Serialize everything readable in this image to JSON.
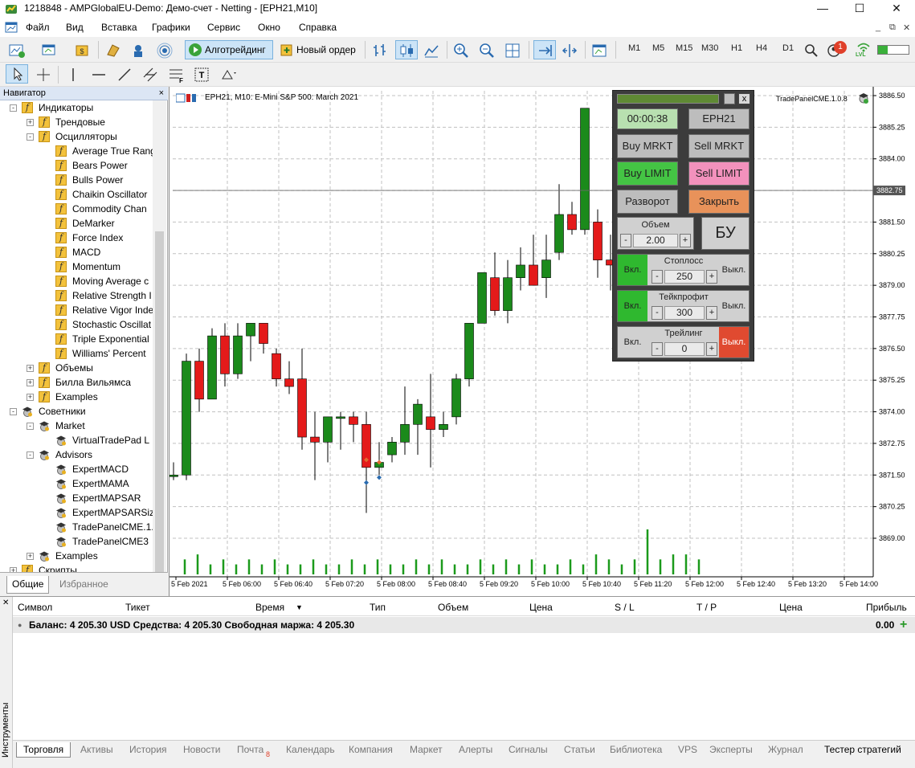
{
  "window": {
    "title": "1218848 - AMPGlobalEU-Demo: Демо-счет - Netting - [EPH21,M10]",
    "controls": {
      "minimize": "—",
      "maximize": "☐",
      "close": "✕"
    },
    "mdi_controls": [
      "_",
      "⧉",
      "✕"
    ]
  },
  "menu": [
    "Файл",
    "Вид",
    "Вставка",
    "Графики",
    "Сервис",
    "Окно",
    "Справка"
  ],
  "toolbar": {
    "algotrading_label": "Алготрейдинг",
    "new_order_label": "Новый ордер",
    "timeframes": [
      "M1",
      "M5",
      "M15",
      "M30",
      "H1",
      "H4",
      "D1"
    ],
    "notification_count": "1",
    "lvl_label": "LVL"
  },
  "navigator": {
    "title": "Навигатор",
    "close": "×",
    "items": [
      {
        "label": "Индикаторы",
        "icon": "f",
        "exp": "-"
      },
      {
        "label": "Трендовые",
        "icon": "f",
        "exp": "+"
      },
      {
        "label": "Осцилляторы",
        "icon": "f",
        "exp": "-"
      },
      {
        "label": "Average True Rang",
        "icon": "f"
      },
      {
        "label": "Bears Power",
        "icon": "f"
      },
      {
        "label": "Bulls Power",
        "icon": "f"
      },
      {
        "label": "Chaikin Oscillator",
        "icon": "f"
      },
      {
        "label": "Commodity Chan",
        "icon": "f"
      },
      {
        "label": "DeMarker",
        "icon": "f"
      },
      {
        "label": "Force Index",
        "icon": "f"
      },
      {
        "label": "MACD",
        "icon": "f"
      },
      {
        "label": "Momentum",
        "icon": "f"
      },
      {
        "label": "Moving Average c",
        "icon": "f"
      },
      {
        "label": "Relative Strength I",
        "icon": "f"
      },
      {
        "label": "Relative Vigor Inde",
        "icon": "f"
      },
      {
        "label": "Stochastic Oscillat",
        "icon": "f"
      },
      {
        "label": "Triple Exponential",
        "icon": "f"
      },
      {
        "label": "Williams' Percent",
        "icon": "f"
      },
      {
        "label": "Объемы",
        "icon": "f",
        "exp": "+"
      },
      {
        "label": "Билла Вильямса",
        "icon": "f",
        "exp": "+"
      },
      {
        "label": "Examples",
        "icon": "f",
        "exp": "+"
      },
      {
        "label": "Советники",
        "icon": "hat",
        "exp": "-"
      },
      {
        "label": "Market",
        "icon": "hat",
        "exp": "-"
      },
      {
        "label": "VirtualTradePad  L",
        "icon": "hat"
      },
      {
        "label": "Advisors",
        "icon": "hat",
        "exp": "-"
      },
      {
        "label": "ExpertMACD",
        "icon": "hat"
      },
      {
        "label": "ExpertMAMA",
        "icon": "hat"
      },
      {
        "label": "ExpertMAPSAR",
        "icon": "hat"
      },
      {
        "label": "ExpertMAPSARSize",
        "icon": "hat"
      },
      {
        "label": "TradePanelCME.1.",
        "icon": "hat"
      },
      {
        "label": "TradePanelCME3",
        "icon": "hat"
      },
      {
        "label": "Examples",
        "icon": "hat",
        "exp": "+"
      },
      {
        "label": "Скрипты",
        "icon": "f",
        "exp": "+"
      }
    ],
    "tabs": [
      "Общие",
      "Избранное"
    ]
  },
  "chart": {
    "header": "EPH21, M10:  E-Mini S&P 500: March 2021",
    "ea_label": "TradePanelCME.1.0.8",
    "current_price": "3882.75",
    "price_axis": [
      "3886.50",
      "3885.25",
      "3884.00",
      "3882.75",
      "3881.50",
      "3880.25",
      "3879.00",
      "3877.75",
      "3876.50",
      "3875.25",
      "3874.00",
      "3872.75",
      "3871.50",
      "3870.25",
      "3869.00"
    ],
    "time_axis": [
      "5 Feb 2021",
      "5 Feb 06:00",
      "5 Feb 06:40",
      "5 Feb 07:20",
      "5 Feb 08:00",
      "5 Feb 08:40",
      "5 Feb 09:20",
      "5 Feb 10:00",
      "5 Feb 10:40",
      "5 Feb 11:20",
      "5 Feb 12:00",
      "5 Feb 12:40",
      "5 Feb 13:20",
      "5 Feb 14:00"
    ],
    "colors": {
      "bull": "#1b8a1b",
      "bear": "#e41a1a",
      "grid": "#c0c0c0",
      "volume": "#1b9a1b"
    },
    "candles": [
      {
        "o": 3871.5,
        "h": 3872.0,
        "l": 3871.3,
        "c": 3871.5
      },
      {
        "o": 3871.5,
        "h": 3876.3,
        "l": 3871.3,
        "c": 3876.0
      },
      {
        "o": 3876.0,
        "h": 3876.5,
        "l": 3874.0,
        "c": 3874.5
      },
      {
        "o": 3874.5,
        "h": 3877.3,
        "l": 3874.5,
        "c": 3877.0
      },
      {
        "o": 3877.0,
        "h": 3877.5,
        "l": 3875.0,
        "c": 3875.5
      },
      {
        "o": 3875.5,
        "h": 3877.5,
        "l": 3875.3,
        "c": 3877.0
      },
      {
        "o": 3877.0,
        "h": 3877.5,
        "l": 3876.0,
        "c": 3877.5
      },
      {
        "o": 3877.5,
        "h": 3877.5,
        "l": 3876.3,
        "c": 3876.7
      },
      {
        "o": 3876.3,
        "h": 3876.5,
        "l": 3875.0,
        "c": 3875.3
      },
      {
        "o": 3875.3,
        "h": 3876.0,
        "l": 3874.7,
        "c": 3875.0
      },
      {
        "o": 3875.3,
        "h": 3876.5,
        "l": 3872.5,
        "c": 3873.0
      },
      {
        "o": 3873.0,
        "h": 3874.0,
        "l": 3871.3,
        "c": 3872.8
      },
      {
        "o": 3872.8,
        "h": 3873.8,
        "l": 3872.0,
        "c": 3873.8
      },
      {
        "o": 3873.8,
        "h": 3874.0,
        "l": 3872.5,
        "c": 3873.8
      },
      {
        "o": 3873.8,
        "h": 3874.0,
        "l": 3872.8,
        "c": 3873.5
      },
      {
        "o": 3873.5,
        "h": 3874.0,
        "l": 3870.0,
        "c": 3871.8
      },
      {
        "o": 3871.8,
        "h": 3872.8,
        "l": 3871.5,
        "c": 3872.0
      },
      {
        "o": 3872.3,
        "h": 3873.0,
        "l": 3872.0,
        "c": 3872.8
      },
      {
        "o": 3872.8,
        "h": 3875.0,
        "l": 3872.3,
        "c": 3873.5
      },
      {
        "o": 3873.5,
        "h": 3874.5,
        "l": 3872.3,
        "c": 3874.3
      },
      {
        "o": 3873.8,
        "h": 3875.5,
        "l": 3871.8,
        "c": 3873.3
      },
      {
        "o": 3873.3,
        "h": 3874.0,
        "l": 3873.0,
        "c": 3873.5
      },
      {
        "o": 3873.8,
        "h": 3875.5,
        "l": 3873.5,
        "c": 3875.3
      },
      {
        "o": 3875.3,
        "h": 3877.5,
        "l": 3875.0,
        "c": 3877.5
      },
      {
        "o": 3877.5,
        "h": 3879.5,
        "l": 3877.5,
        "c": 3879.5
      },
      {
        "o": 3879.3,
        "h": 3880.3,
        "l": 3877.8,
        "c": 3878.0
      },
      {
        "o": 3878.0,
        "h": 3880.0,
        "l": 3877.5,
        "c": 3879.3
      },
      {
        "o": 3879.3,
        "h": 3880.5,
        "l": 3878.8,
        "c": 3879.8
      },
      {
        "o": 3879.8,
        "h": 3881.0,
        "l": 3879.0,
        "c": 3879.0
      },
      {
        "o": 3879.3,
        "h": 3881.0,
        "l": 3878.5,
        "c": 3880.0
      },
      {
        "o": 3880.3,
        "h": 3883.0,
        "l": 3880.0,
        "c": 3881.8
      },
      {
        "o": 3881.8,
        "h": 3882.3,
        "l": 3881.0,
        "c": 3881.2
      },
      {
        "o": 3881.2,
        "h": 3886.0,
        "l": 3881.0,
        "c": 3886.0
      },
      {
        "o": 3881.5,
        "h": 3882.0,
        "l": 3879.3,
        "c": 3880.0
      },
      {
        "o": 3880.0,
        "h": 3881.0,
        "l": 3878.8,
        "c": 3879.8
      },
      {
        "o": 3880.2,
        "h": 3881.8,
        "l": 3879.0,
        "c": 3881.3
      },
      {
        "o": 3881.3,
        "h": 3882.3,
        "l": 3876.5,
        "c": 3881.5
      },
      {
        "o": 3881.5,
        "h": 3882.3,
        "l": 3880.8,
        "c": 3881.2
      },
      {
        "o": 3881.5,
        "h": 3882.3,
        "l": 3878.5,
        "c": 3880.0
      },
      {
        "o": 3880.0,
        "h": 3884.5,
        "l": 3879.8,
        "c": 3883.8
      },
      {
        "o": 3884.0,
        "h": 3884.8,
        "l": 3882.3,
        "c": 3882.8
      }
    ],
    "volumes": [
      3,
      4,
      2,
      3,
      2,
      3,
      2,
      3,
      2,
      2,
      3,
      2,
      2,
      3,
      2,
      3,
      2,
      2,
      3,
      2,
      3,
      2,
      2,
      3,
      2,
      3,
      2,
      3,
      2,
      2,
      3,
      2,
      4,
      3,
      2,
      3,
      9,
      3,
      4,
      4,
      3
    ]
  },
  "trade_panel": {
    "timer": "00:00:38",
    "symbol": "EPH21",
    "buy_market": "Buy MRKT",
    "sell_market": "Sell MRKT",
    "buy_limit": "Buy LIMIT",
    "sell_limit": "Sell LIMIT",
    "reverse": "Разворот",
    "close": "Закрыть",
    "volume_label": "Объем",
    "volume_value": "2.00",
    "breakeven": "БУ",
    "stoploss_label": "Стоплосс",
    "stoploss_value": "250",
    "takeprofit_label": "Тейкпрофит",
    "takeprofit_value": "300",
    "trailing_label": "Трейлинг",
    "trailing_value": "0",
    "on": "Вкл.",
    "off": "Выкл.",
    "minus": "-",
    "plus": "+",
    "close_x": "x"
  },
  "terminal": {
    "side_label": "Инструменты",
    "columns": [
      "Символ",
      "Тикет",
      "Время",
      "Тип",
      "Объем",
      "Цена",
      "S / L",
      "T / P",
      "Цена",
      "Прибыль"
    ],
    "balance_text": "Баланс: 4 205.30 USD  Средства: 4 205.30  Свободная маржа: 4 205.30",
    "profit_total": "0.00",
    "tabs": [
      "Торговля",
      "Активы",
      "История",
      "Новости",
      "Почта",
      "Календарь",
      "Компания",
      "Маркет",
      "Алерты",
      "Сигналы",
      "Статьи",
      "Библиотека",
      "VPS",
      "Эксперты",
      "Журнал"
    ],
    "mail_count": "8",
    "tester_label": "Тестер стратегий"
  }
}
